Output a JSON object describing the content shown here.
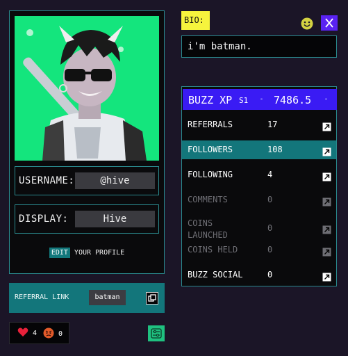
{
  "profile": {
    "username_label": "USERNAME:",
    "username": "@hive",
    "display_label": "DISPLAY:",
    "display_name": "Hive",
    "edit_label": "EDIT",
    "edit_suffix": "YOUR PROFILE"
  },
  "referral": {
    "label": "REFERRAL LINK",
    "code": "batman"
  },
  "reactions": {
    "hearts": "4",
    "angry": "0"
  },
  "bio": {
    "label": "BIO:",
    "text": "i'm batman."
  },
  "stats": {
    "xp_title": "BUZZ XP",
    "xp_season": "S1",
    "xp_value": "7486.5",
    "rows": [
      {
        "label": "REFERRALS",
        "value": "17",
        "active": true
      },
      {
        "label": "FOLLOWERS",
        "value": "108",
        "active": true
      },
      {
        "label": "FOLLOWING",
        "value": "4",
        "active": true
      },
      {
        "label": "COMMENTS",
        "value": "0",
        "active": false
      },
      {
        "label": "COINS\nLAUNCHED",
        "value": "0",
        "active": false
      },
      {
        "label": "COINS HELD",
        "value": "0",
        "active": false
      },
      {
        "label": "BUZZ SOCIAL",
        "value": "0",
        "active": true
      }
    ]
  },
  "colors": {
    "teal": "#13767b",
    "purple": "#3a1bf4",
    "bio_yellow": "#f6f43d",
    "avatar_green": "#14e57d"
  }
}
